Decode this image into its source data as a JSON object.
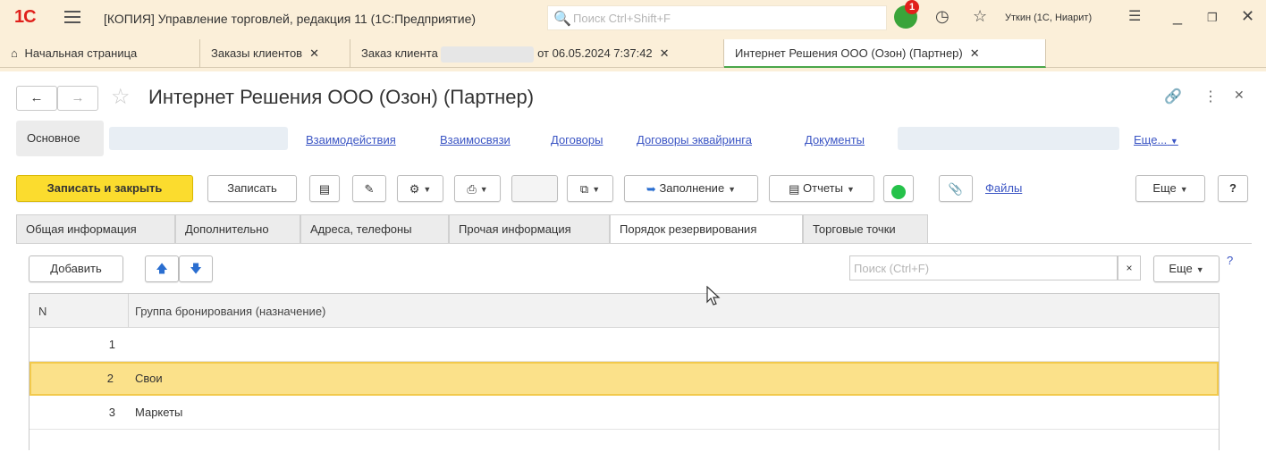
{
  "titlebar": {
    "logo": "1С",
    "app_title": "[КОПИЯ] Управление торговлей, редакция 11  (1С:Предприятие)",
    "search_placeholder": "Поиск Ctrl+Shift+F",
    "notification_count": "1",
    "user": "Уткин (1С, Ниарит)"
  },
  "open_tabs": {
    "home": "Начальная страница",
    "tab1": "Заказы клиентов",
    "tab2_prefix": "Заказ клиента",
    "tab2_suffix": "от 06.05.2024 7:37:42",
    "tab3": "Интернет Решения ООО (Озон) (Партнер)"
  },
  "form": {
    "title": "Интернет Решения ООО (Озон) (Партнер)",
    "sections": {
      "main": "Основное",
      "links": [
        "Взаимодействия",
        "Взаимосвязи",
        "Договоры",
        "Договоры эквайринга",
        "Документы"
      ],
      "more": "Еще..."
    },
    "toolbar": {
      "save_close": "Записать и закрыть",
      "save": "Записать",
      "fill": "Заполнение",
      "reports": "Отчеты",
      "files": "Файлы",
      "more": "Еще",
      "help": "?"
    },
    "tabs": [
      "Общая информация",
      "Дополнительно",
      "Адреса, телефоны",
      "Прочая информация",
      "Порядок резервирования",
      "Торговые точки"
    ],
    "table_toolbar": {
      "add": "Добавить",
      "search_placeholder": "Поиск (Ctrl+F)",
      "clear": "×",
      "more": "Еще",
      "help": "?"
    },
    "table": {
      "columns": [
        "N",
        "Группа бронирования (назначение)"
      ],
      "rows": [
        {
          "n": "1",
          "group": ""
        },
        {
          "n": "2",
          "group": "Свои"
        },
        {
          "n": "3",
          "group": "Маркеты"
        }
      ]
    }
  }
}
